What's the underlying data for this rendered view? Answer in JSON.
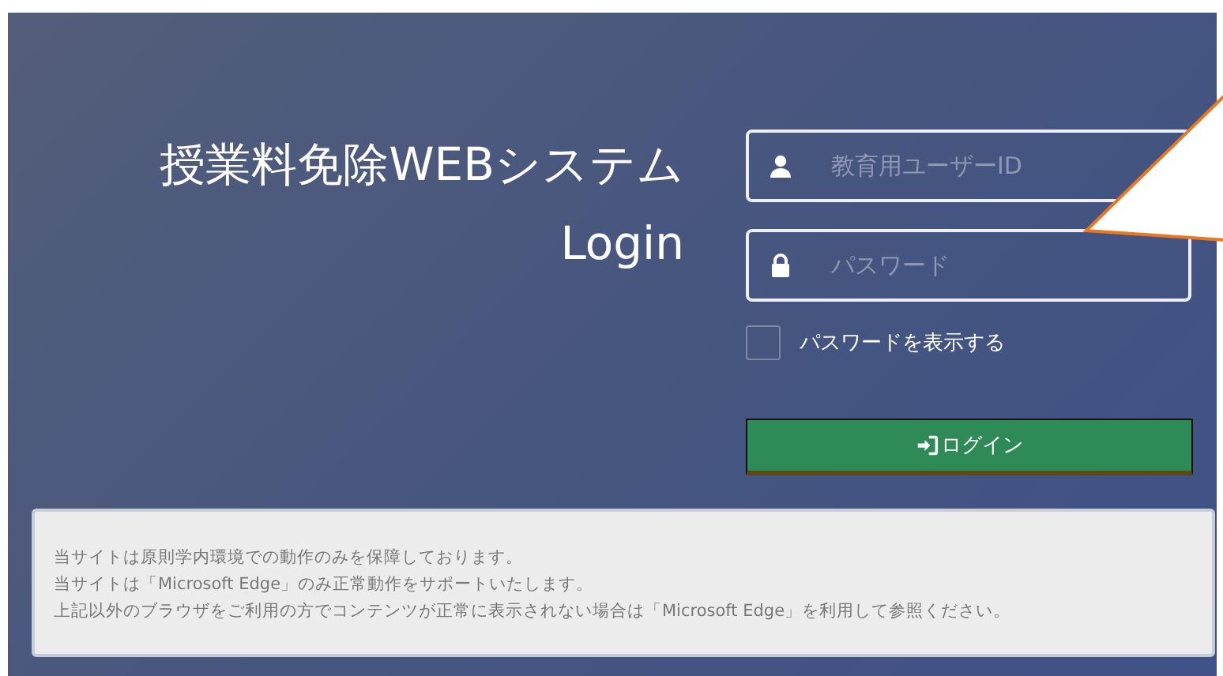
{
  "header": {
    "title": "授業料免除WEBシステム",
    "subtitle": "Login"
  },
  "login_form": {
    "fields": [
      {
        "kind": "user",
        "placeholder": "教育用ユーザーID"
      },
      {
        "kind": "password",
        "placeholder": "パスワード"
      }
    ],
    "show_password": {
      "label": "パスワードを表示する",
      "checked": false
    },
    "login_button": {
      "label": "ログイン"
    }
  },
  "notice": {
    "lines": [
      "当サイトは原則学内環境での動作のみを保障しております。",
      "当サイトは「Microsoft Edge」のみ正常動作をサポートいたします。",
      "上記以外のブラウザをご利用の方でコンテンツが正常に表示されない場合は「Microsoft Edge」を利用して参照ください。"
    ]
  }
}
